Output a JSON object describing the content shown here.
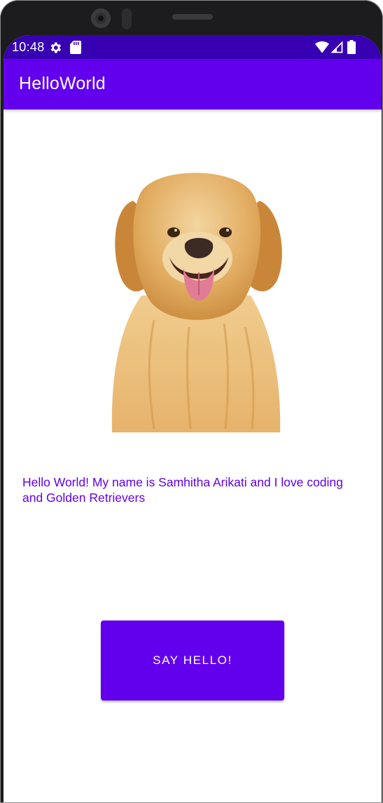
{
  "status_bar": {
    "time": "10:48",
    "icons": [
      "settings-gear-icon",
      "sd-card-icon",
      "wifi-icon",
      "cell-signal-icon",
      "battery-icon"
    ]
  },
  "app_bar": {
    "title": "HelloWorld"
  },
  "main": {
    "image": {
      "icon": "golden-retriever-photo"
    },
    "message": "Hello World! My name is Samhitha Arikati and I love coding and Golden Retrievers",
    "button_label": "SAY HELLO!"
  },
  "colors": {
    "status_bar": "#3700b3",
    "primary": "#6200ee",
    "text_on_primary": "#ffffff",
    "background": "#ffffff"
  }
}
